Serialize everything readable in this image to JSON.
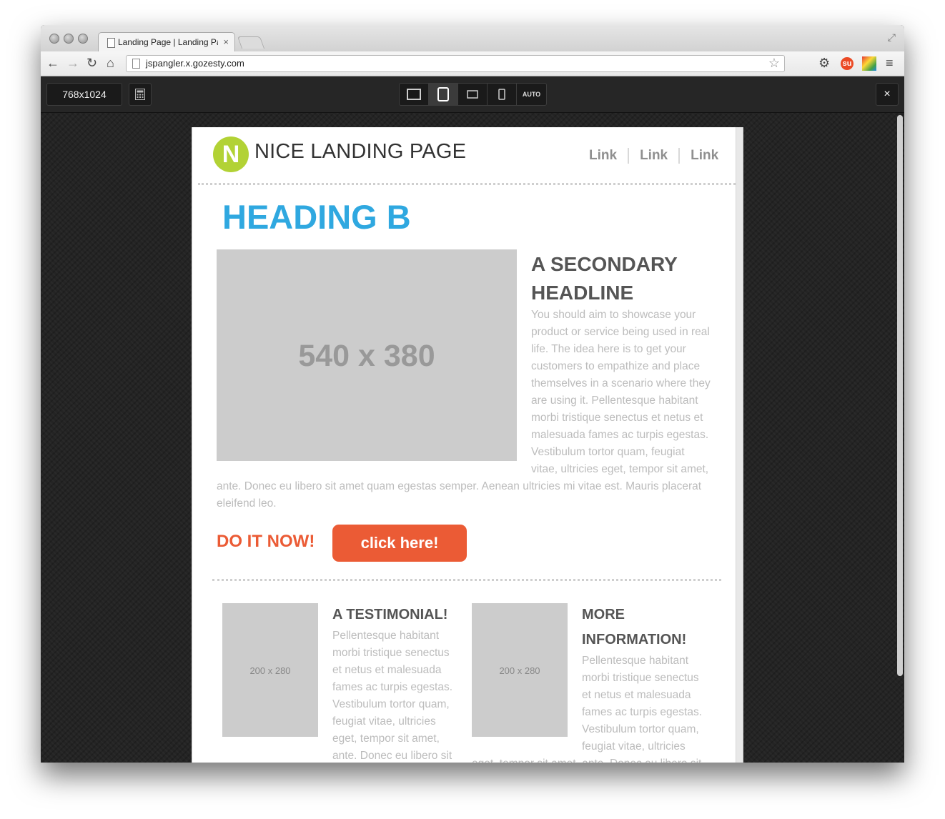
{
  "browser": {
    "tab_title": "Landing Page | Landing Pa",
    "tab_close": "×",
    "url": "jspangler.x.gozesty.com"
  },
  "responsive_bar": {
    "size_label": "768x1024",
    "auto_label": "AUTO",
    "close_label": "×"
  },
  "landing": {
    "logo_letter": "N",
    "logo_text": "NICE LANDING PAGE",
    "nav": [
      "Link",
      "Link",
      "Link"
    ],
    "heading": "HEADING B",
    "hero_image_label": "540 x 380",
    "secondary_headline": "A SECONDARY HEADLINE",
    "secondary_body_lines": [
      "You should aim to showcase your",
      "product or service being used in real",
      "life. The idea here is to get your",
      "customers to empathize and place",
      "themselves in a scenario where they",
      "are using it. Pellentesque habitant",
      "morbi tristique senectus et netus et",
      "malesuada fames ac turpis egestas.",
      "Vestibulum tortor quam, feugiat",
      "vitae, ultricies eget, tempor sit amet,"
    ],
    "secondary_body_wide_lines": [
      "ante. Donec eu libero sit amet quam egestas semper. Aenean ultricies mi vitae est. Mauris placerat",
      "eleifend leo."
    ],
    "cta_text": "DO IT NOW!",
    "cta_button": "click here!",
    "testimonial": {
      "image_label": "200 x 280",
      "heading": "A TESTIMONIAL!",
      "body_lines": [
        "Pellentesque habitant",
        "morbi tristique senectus",
        "et netus et malesuada",
        "fames ac turpis egestas.",
        "Vestibulum tortor quam,",
        "feugiat vitae, ultricies",
        "eget, tempor sit amet,",
        "ante. Donec eu libero sit"
      ]
    },
    "more_info": {
      "image_label": "200 x 280",
      "heading_lines": [
        "MORE",
        "INFORMATION!"
      ],
      "body_lines": [
        "Pellentesque habitant",
        "morbi tristique senectus",
        "et netus et malesuada",
        "fames ac turpis egestas.",
        "Vestibulum tortor quam,",
        "feugiat vitae, ultricies"
      ],
      "wide_line": "eget, tempor sit amet, ante. Donec eu libero sit"
    }
  }
}
